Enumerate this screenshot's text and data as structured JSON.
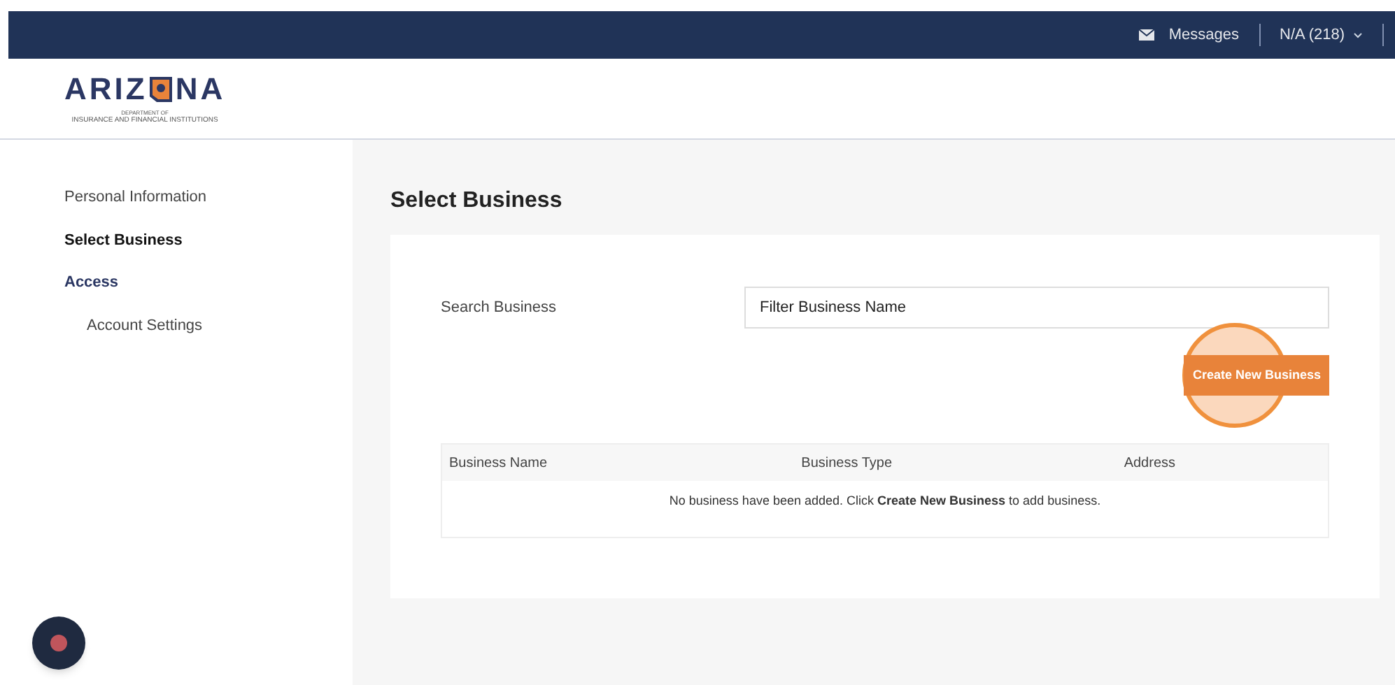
{
  "top_bar": {
    "messages": "Messages",
    "user": "N/A (218)"
  },
  "logo": {
    "left": "ARIZ",
    "right": "NA",
    "department": "DEPARTMENT OF",
    "subtitle": "INSURANCE AND FINANCIAL INSTITUTIONS"
  },
  "sidebar": {
    "items": [
      {
        "label": "Personal Information",
        "selected": false
      },
      {
        "label": "Select Business",
        "selected": true
      },
      {
        "label": "Access",
        "selected": false,
        "children": [
          {
            "label": "Account Settings",
            "selected": false
          }
        ]
      }
    ]
  },
  "page": {
    "title": "Select Business",
    "search": {
      "label": "Search Business",
      "placeholder": "Filter Business Name"
    },
    "create_button": "Create New Business",
    "table": {
      "columns": [
        "Business Name",
        "Business Type",
        "Address"
      ],
      "empty_message": "No business have been added. Click **Create New Business** to add business."
    }
  }
}
